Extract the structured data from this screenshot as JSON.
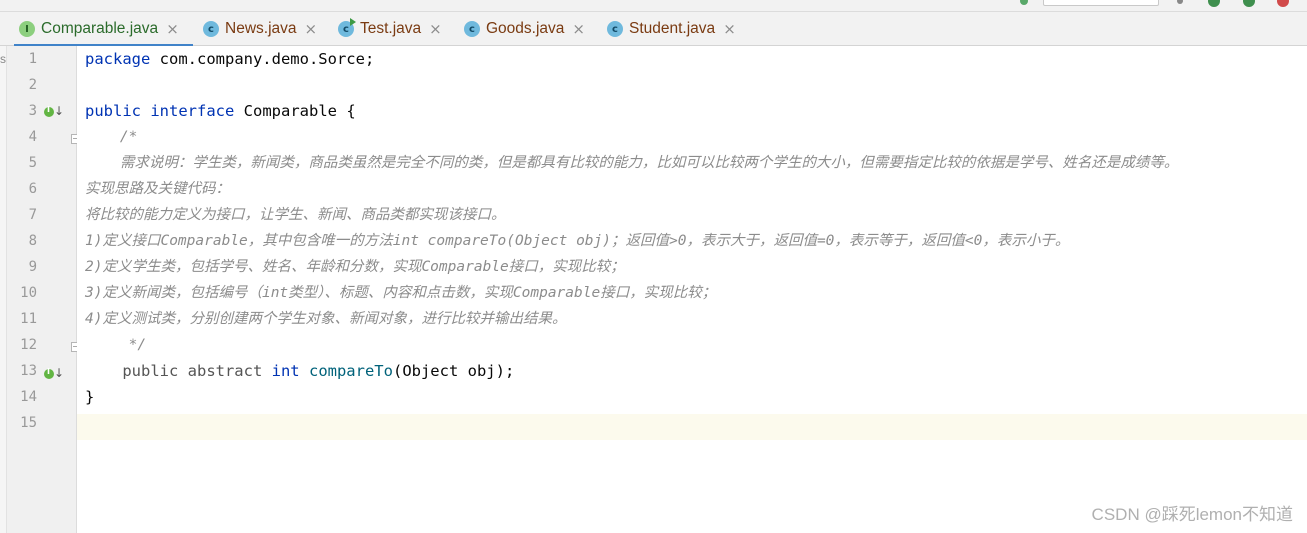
{
  "tabs": [
    {
      "label": "Comparable.java",
      "icon": "interface-icon",
      "glyph": "I",
      "active": true
    },
    {
      "label": "News.java",
      "icon": "class-icon",
      "glyph": "c",
      "active": false
    },
    {
      "label": "Test.java",
      "icon": "runnable-class-icon",
      "glyph": "c",
      "active": false
    },
    {
      "label": "Goods.java",
      "icon": "class-icon",
      "glyph": "c",
      "active": false
    },
    {
      "label": "Student.java",
      "icon": "class-icon",
      "glyph": "c",
      "active": false
    }
  ],
  "tab_close_glyph": "×",
  "left_strip_char": "s",
  "line_numbers": [
    "1",
    "2",
    "3",
    "4",
    "5",
    "6",
    "7",
    "8",
    "9",
    "10",
    "11",
    "12",
    "13",
    "14",
    "15"
  ],
  "code": {
    "l1_kw": "package",
    "l1_rest": " com.company.demo.Sorce;",
    "l3_kw1": "public",
    "l3_kw2": "interface",
    "l3_rest": " Comparable {",
    "l4": "    /*",
    "l5": "    需求说明：学生类，新闻类，商品类虽然是完全不同的类，但是都具有比较的能力，比如可以比较两个学生的大小，但需要指定比较的依据是学号、姓名还是成绩等。",
    "l6": "实现思路及关键代码：",
    "l7": "将比较的能力定义为接口，让学生、新闻、商品类都实现该接口。",
    "l8": "1)定义接口Comparable，其中包含唯一的方法int compareTo(Object obj)；返回值>0，表示大于，返回值=0，表示等于，返回值<0，表示小于。",
    "l9": "2)定义学生类，包括学号、姓名、年龄和分数，实现Comparable接口，实现比较；",
    "l10": "3)定义新闻类，包括编号（int类型）、标题、内容和点击数，实现Comparable接口，实现比较；",
    "l11": "4)定义测试类，分别创建两个学生对象、新闻对象，进行比较并输出结果。",
    "l12": "     */",
    "l13_pre": "    public abstract ",
    "l13_kw": "int",
    "l13_fn": "compareTo",
    "l13_rest": "(Object obj);",
    "l14": "}"
  },
  "watermark": "CSDN @踩死lemon不知道",
  "colors": {
    "keyword": "#0033b3",
    "method": "#00627a",
    "comment": "#8c8c8c",
    "current_line": "#fcfaed",
    "active_tab_underline": "#4083c9"
  }
}
